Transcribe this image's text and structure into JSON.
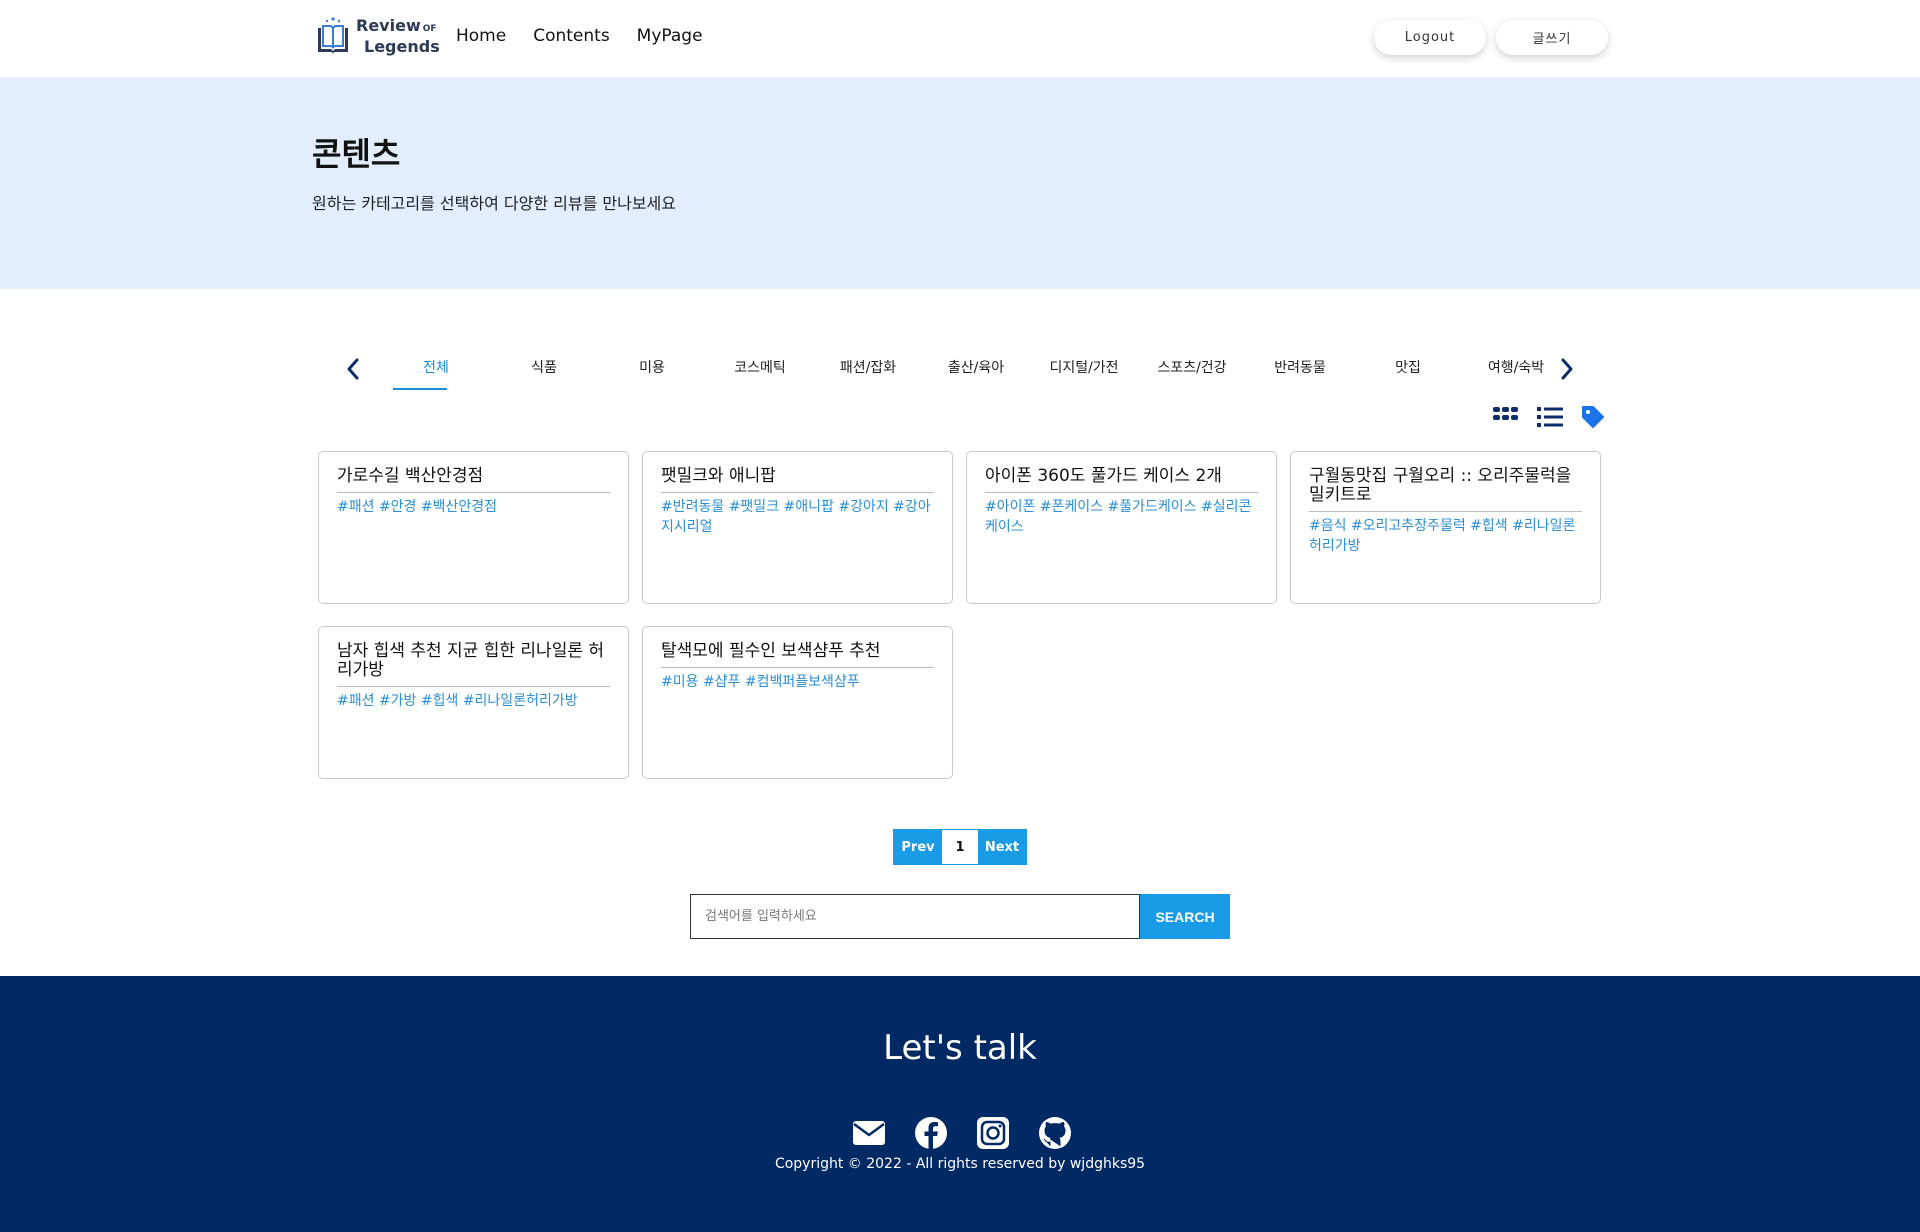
{
  "header": {
    "logo_line1": "Review",
    "logo_of": "OF",
    "logo_line2": "Legends",
    "nav": [
      "Home",
      "Contents",
      "MyPage"
    ],
    "logout_label": "Logout",
    "write_label": "글쓰기"
  },
  "hero": {
    "title": "콘텐츠",
    "subtitle": "원하는 카테고리를 선택하여 다양한 리뷰를 만나보세요"
  },
  "categories": {
    "items": [
      "전체",
      "식품",
      "미용",
      "코스메틱",
      "패션/잡화",
      "출산/육아",
      "디지털/가전",
      "스포츠/건강",
      "반려동물",
      "맛집",
      "여행/숙박"
    ],
    "active": "전체",
    "prev_icon": "chevron-left-icon",
    "next_icon": "chevron-right-icon"
  },
  "view_icons": [
    "grid-view-icon",
    "list-view-icon",
    "tag-icon"
  ],
  "cards": [
    {
      "title": "가로수길 백산안경점",
      "tags": "#패션 #안경 #백산안경점"
    },
    {
      "title": "팻밀크와 애니팝",
      "tags": "#반려동물 #팻밀크 #애니팝 #강아지 #강아지시리얼"
    },
    {
      "title": "아이폰 360도 풀가드 케이스 2개",
      "tags": "#아이폰 #폰케이스 #풀가드케이스 #실리콘케이스"
    },
    {
      "title": "구월동맛집 구월오리 :: 오리주물럭을 밀키트로",
      "tags": "#음식 #오리고추장주물럭 #힙색 #리나일론 허리가방"
    },
    {
      "title": "남자 힙색 추천 지균 힙한 리나일론 허리가방",
      "tags": "#패션 #가방 #힙색 #리나일론허리가방"
    },
    {
      "title": "탈색모에 필수인 보색샴푸 추천",
      "tags": "#미용 #샴푸 #컴백퍼플보색샴푸"
    }
  ],
  "pagination": {
    "prev": "Prev",
    "current": "1",
    "next": "Next"
  },
  "search": {
    "placeholder": "검색어를 입력하세요",
    "button": "SEARCH"
  },
  "footer": {
    "title": "Let's talk",
    "social": [
      "mail-icon",
      "facebook-icon",
      "instagram-icon",
      "github-icon"
    ],
    "copyright": "Copyright © 2022 - All rights reserved by wjdghks95"
  },
  "colors": {
    "accent": "#1a9be6",
    "hero_bg": "#e2eefd",
    "footer_bg": "#012963",
    "tag": "#2a8fd6",
    "icon_navy": "#0d2d6b"
  }
}
